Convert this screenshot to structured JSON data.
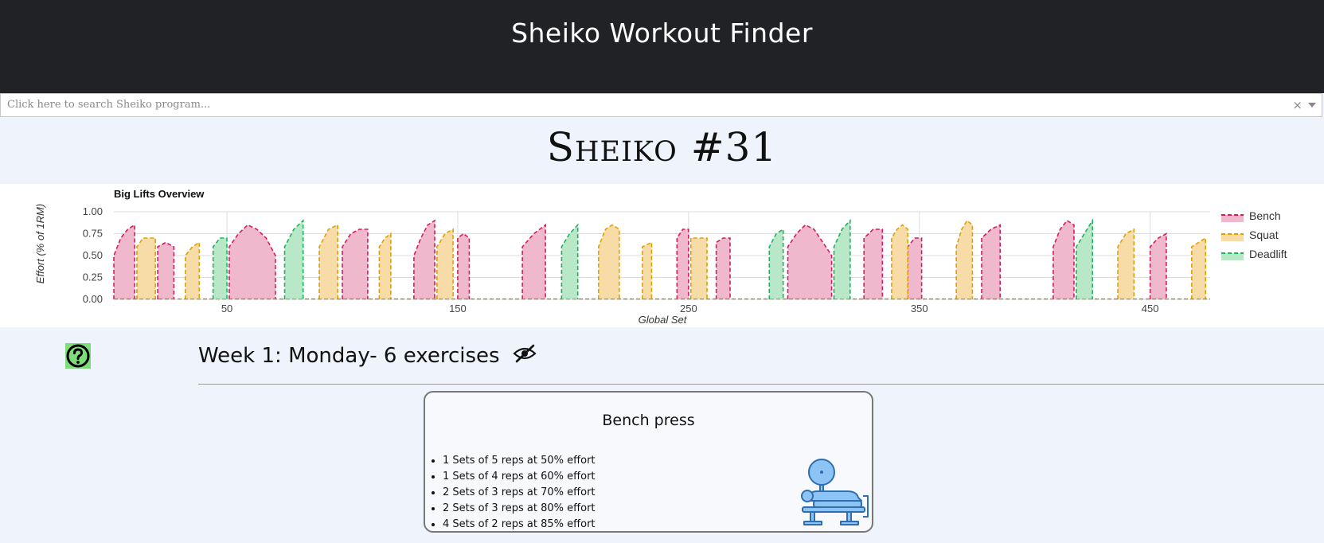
{
  "header": {
    "title": "Sheiko Workout Finder"
  },
  "search": {
    "placeholder": "Click here to search Sheiko program...",
    "clear_glyph": "×"
  },
  "program": {
    "title": "Sheiko #31"
  },
  "chart_data": {
    "type": "area",
    "title": "Big Lifts Overview",
    "xlabel": "Global Set",
    "ylabel": "Effort (% of 1RM)",
    "xlim": [
      1,
      476
    ],
    "ylim": [
      0,
      1
    ],
    "x_ticks": [
      "50",
      "150",
      "250",
      "350",
      "450"
    ],
    "y_ticks": [
      "0.00",
      "0.25",
      "0.50",
      "0.75",
      "1.00"
    ],
    "grid": true,
    "legend_position": "right",
    "series": [
      {
        "name": "Bench",
        "color": "#d81b60",
        "fill": "#efb8cc",
        "blocks": [
          [
            1,
            10,
            [
              0.5,
              0.7,
              0.8,
              0.85
            ]
          ],
          [
            20,
            27,
            [
              0.6,
              0.65,
              0.6
            ]
          ],
          [
            51,
            71,
            [
              0.6,
              0.75,
              0.85,
              0.8,
              0.7,
              0.5
            ]
          ],
          [
            100,
            111,
            [
              0.6,
              0.75,
              0.8,
              0.8
            ]
          ],
          [
            131,
            140,
            [
              0.5,
              0.7,
              0.85,
              0.9
            ]
          ],
          [
            150,
            155,
            [
              0.7,
              0.75,
              0.7
            ]
          ],
          [
            178,
            188,
            [
              0.6,
              0.75,
              0.85
            ]
          ],
          [
            245,
            250,
            [
              0.7,
              0.8,
              0.8
            ]
          ],
          [
            262,
            268,
            [
              0.65,
              0.7,
              0.7
            ]
          ],
          [
            293,
            312,
            [
              0.6,
              0.75,
              0.85,
              0.8,
              0.65,
              0.5
            ]
          ],
          [
            326,
            334,
            [
              0.7,
              0.8,
              0.8
            ]
          ],
          [
            345,
            351,
            [
              0.6,
              0.7,
              0.7
            ]
          ],
          [
            377,
            385,
            [
              0.7,
              0.8,
              0.85
            ]
          ],
          [
            408,
            417,
            [
              0.6,
              0.8,
              0.9,
              0.85
            ]
          ],
          [
            450,
            457,
            [
              0.6,
              0.7,
              0.75
            ]
          ]
        ]
      },
      {
        "name": "Squat",
        "color": "#e0a000",
        "fill": "#f7dca8",
        "blocks": [
          [
            11,
            19,
            [
              0.6,
              0.7,
              0.7,
              0.7
            ]
          ],
          [
            32,
            38,
            [
              0.5,
              0.6,
              0.65
            ]
          ],
          [
            90,
            98,
            [
              0.6,
              0.8,
              0.85
            ]
          ],
          [
            116,
            121,
            [
              0.6,
              0.7,
              0.75
            ]
          ],
          [
            141,
            148,
            [
              0.6,
              0.75,
              0.8
            ]
          ],
          [
            211,
            220,
            [
              0.6,
              0.8,
              0.85,
              0.8
            ]
          ],
          [
            230,
            234,
            [
              0.6,
              0.65
            ]
          ],
          [
            251,
            258,
            [
              0.7,
              0.7,
              0.7
            ]
          ],
          [
            338,
            345,
            [
              0.7,
              0.8,
              0.85,
              0.8
            ]
          ],
          [
            366,
            373,
            [
              0.6,
              0.8,
              0.9,
              0.85
            ]
          ],
          [
            436,
            443,
            [
              0.6,
              0.75,
              0.8
            ]
          ],
          [
            468,
            474,
            [
              0.6,
              0.7
            ]
          ]
        ]
      },
      {
        "name": "Deadlift",
        "color": "#1db35c",
        "fill": "#b9e8c8",
        "blocks": [
          [
            44,
            50,
            [
              0.6,
              0.7,
              0.7
            ]
          ],
          [
            75,
            83,
            [
              0.6,
              0.8,
              0.9
            ]
          ],
          [
            195,
            202,
            [
              0.6,
              0.75,
              0.85
            ]
          ],
          [
            285,
            291,
            [
              0.6,
              0.75,
              0.8
            ]
          ],
          [
            313,
            320,
            [
              0.6,
              0.8,
              0.9
            ]
          ],
          [
            418,
            425,
            [
              0.6,
              0.75,
              0.9
            ]
          ]
        ]
      }
    ]
  },
  "day": {
    "title": "Week 1: Monday- 6 exercises"
  },
  "exercise": {
    "name": "Bench press",
    "sets": [
      "1 Sets of 5 reps at 50% effort",
      "1 Sets of 4 reps at 60% effort",
      "2 Sets of 3 reps at 70% effort",
      "2 Sets of 3 reps at 80% effort",
      "4 Sets of 2 reps at 85% effort"
    ]
  },
  "icons": {
    "help": "question-circle-icon",
    "hide": "eye-slash-icon",
    "exercise": "bench-press-icon"
  }
}
